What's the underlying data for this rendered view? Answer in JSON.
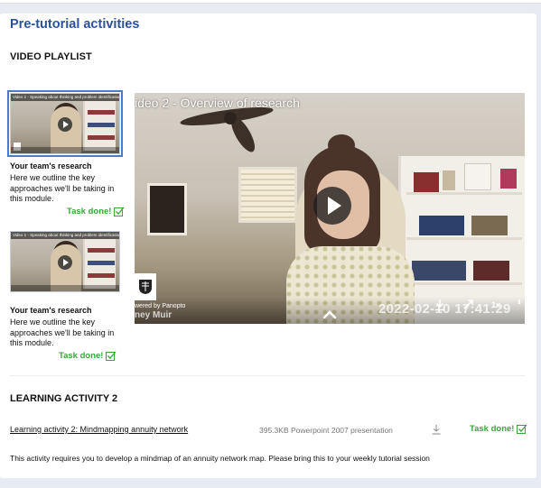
{
  "page": {
    "title": "Pre-tutorial activities"
  },
  "playlist": {
    "heading": "VIDEO PLAYLIST",
    "items": [
      {
        "thumb_caption": "Video 1 - Speaking about thinking and problem identification",
        "title": "Your team's research",
        "description": "Here we outline the key approaches we'll be taking in this module.",
        "status": "Task done!",
        "active": true
      },
      {
        "thumb_caption": "Video 1 - Speaking about thinking and problem identification",
        "title": "Your team's research",
        "description": "Here we outline the key approaches we'll be taking in this module.",
        "status": "Task done!",
        "active": false
      }
    ]
  },
  "player": {
    "video_title": "ideo 2 - Overview of research",
    "powered_by": "wered by Panopto",
    "presenter": "ney Muir",
    "timestamp": "2022-02-10 17:41:29",
    "speed": "1x",
    "play_icon": "play-icon",
    "download_icon": "download-icon",
    "expand_icon": "expand-icon",
    "chevron_icon": "chevron-up-icon"
  },
  "learning_activity": {
    "heading": "LEARNING ACTIVITY 2",
    "link_label": "Learning activity 2: Mindmapping annuity network",
    "file_meta": "395.3KB Powerpoint 2007 presentation",
    "status": "Task done!",
    "description": "This activity requires you to develop a mindmap of an annuity network map. Please bring this to your weekly tutorial session"
  },
  "colors": {
    "accent_blue": "#2a5298",
    "success_green": "#3aa63a",
    "active_outline": "#4b7bd1"
  }
}
